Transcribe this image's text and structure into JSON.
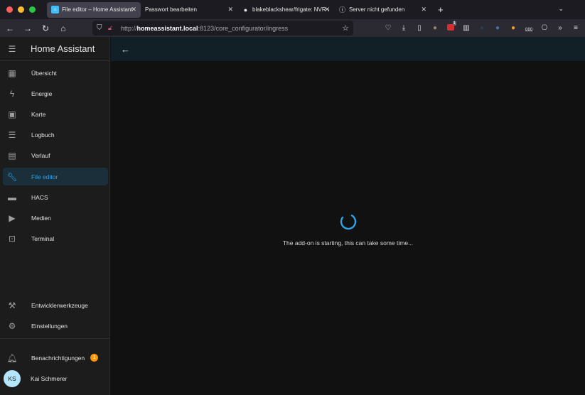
{
  "browser": {
    "tabs": [
      {
        "title": "File editor – Home Assistant",
        "icon": "home-assistant-icon",
        "active": true
      },
      {
        "title": "Passwort bearbeiten",
        "icon": "",
        "active": false
      },
      {
        "title": "blakeblackshear/frigate: NVR w",
        "icon": "github-icon",
        "active": false
      },
      {
        "title": "Server nicht gefunden",
        "icon": "info-icon",
        "active": false
      }
    ],
    "url_scheme": "http://",
    "url_host": "homeassistant.local",
    "url_rest": ":8123/core_configurator/ingress",
    "toolbar_badge": "1"
  },
  "sidebar": {
    "title": "Home Assistant",
    "items": [
      {
        "label": "Übersicht",
        "icon": "dashboard-icon"
      },
      {
        "label": "Energie",
        "icon": "lightning-icon"
      },
      {
        "label": "Karte",
        "icon": "map-account-icon"
      },
      {
        "label": "Logbuch",
        "icon": "list-icon"
      },
      {
        "label": "Verlauf",
        "icon": "chart-icon"
      },
      {
        "label": "File editor",
        "icon": "wrench-icon",
        "active": true
      },
      {
        "label": "HACS",
        "icon": "hacs-icon"
      },
      {
        "label": "Medien",
        "icon": "media-icon"
      },
      {
        "label": "Terminal",
        "icon": "terminal-icon"
      }
    ],
    "bottom_items": [
      {
        "label": "Entwicklerwerkzeuge",
        "icon": "hammer-icon"
      },
      {
        "label": "Einstellungen",
        "icon": "gear-icon"
      }
    ],
    "notifications": {
      "label": "Benachrichtigungen",
      "count": "1"
    },
    "user": {
      "name": "Kai Schmerer",
      "initials": "KS"
    }
  },
  "main": {
    "message": "The add-on is starting, this can take some time..."
  },
  "colors": {
    "accent": "#2ea3e5",
    "badge": "#ff9800",
    "avatar": "#b3e5fc"
  }
}
